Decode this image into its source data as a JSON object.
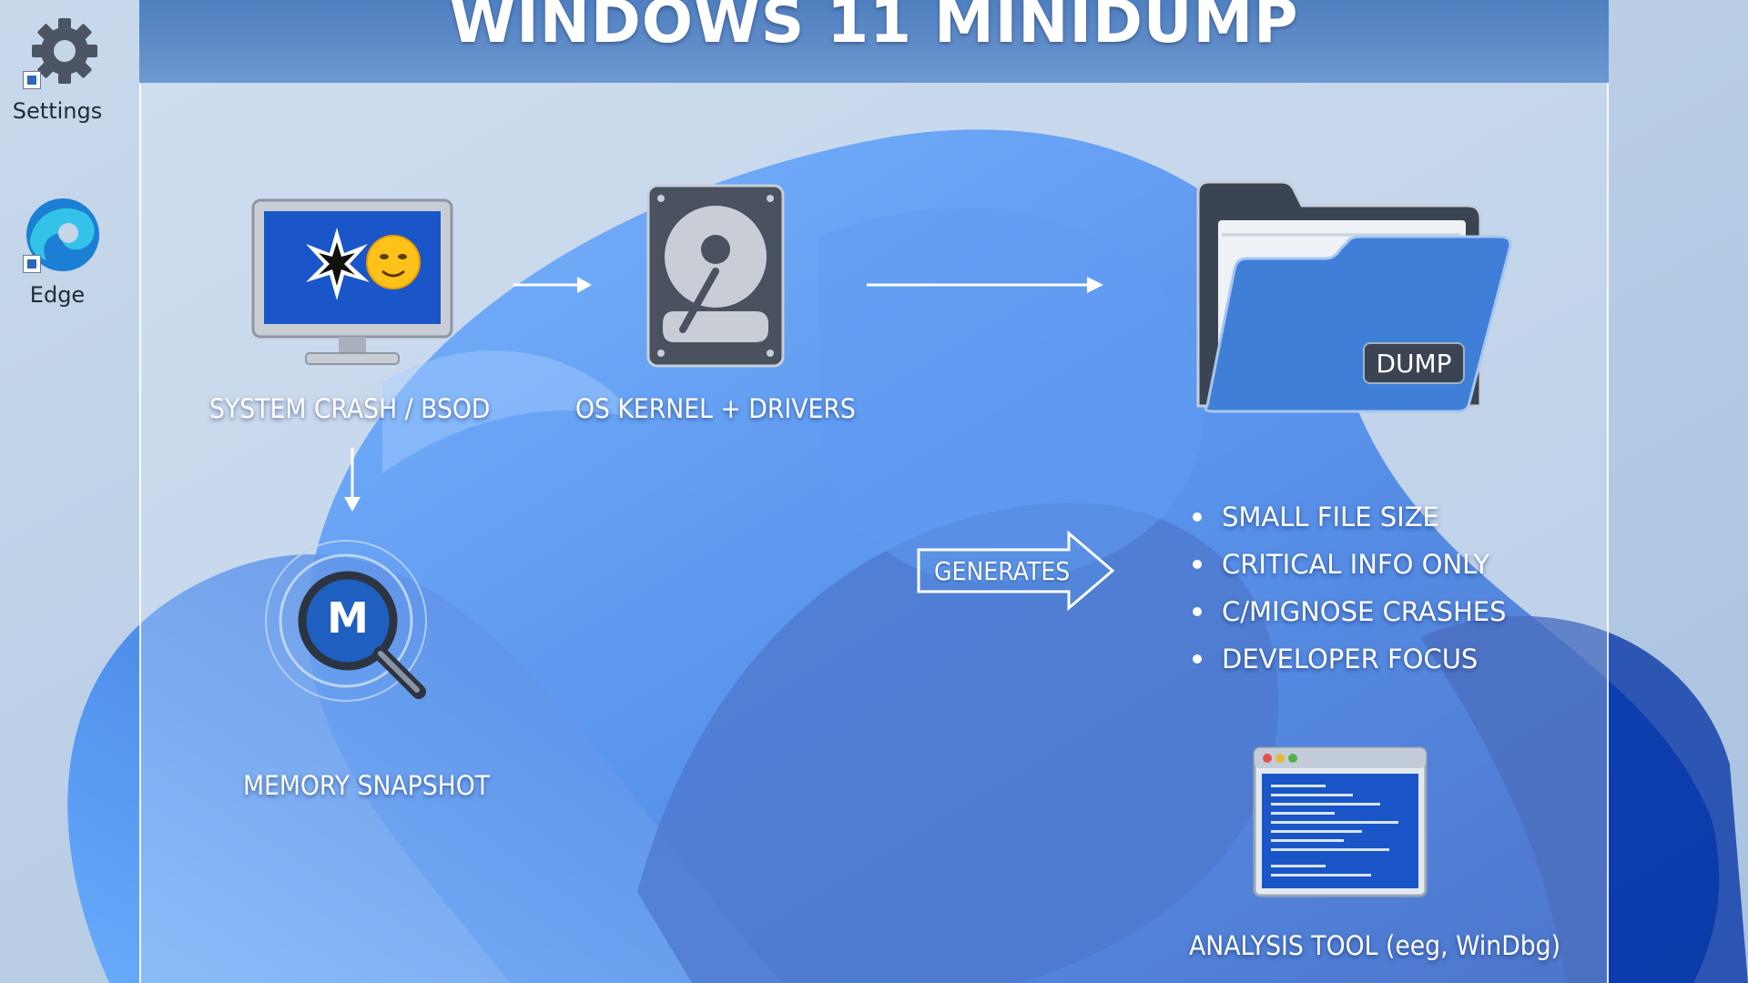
{
  "desktop": {
    "icons": [
      {
        "label": "Settings",
        "icon": "gear-icon"
      },
      {
        "label": "Edge",
        "icon": "edge-icon"
      }
    ]
  },
  "panel": {
    "title": "WINDOWS 11 MINIDUMP"
  },
  "flow": {
    "crash_label": "SYSTEM CRASH / BSOD",
    "kernel_label": "OS KERNEL + DRIVERS",
    "memory_label": "MEMORY SNAPSHOT",
    "memory_badge": "M",
    "dump_badge": "DUMP",
    "generates_label": "GENERATES",
    "features": [
      "SMALL FILE SIZE",
      "CRITICAL INFO ONLY",
      "C/MIGNOSE CRASHES",
      "DEVELOPER FOCUS"
    ],
    "tool_label": "ANALYSIS TOOL (eeg, WinDbg)"
  },
  "colors": {
    "accent": "#2f6fd6",
    "panel_title_bar": "#5b88c6",
    "bsod_blue": "#1a56c8",
    "disk_gray": "#4a5260",
    "folder_blue": "#3f7fd8"
  }
}
